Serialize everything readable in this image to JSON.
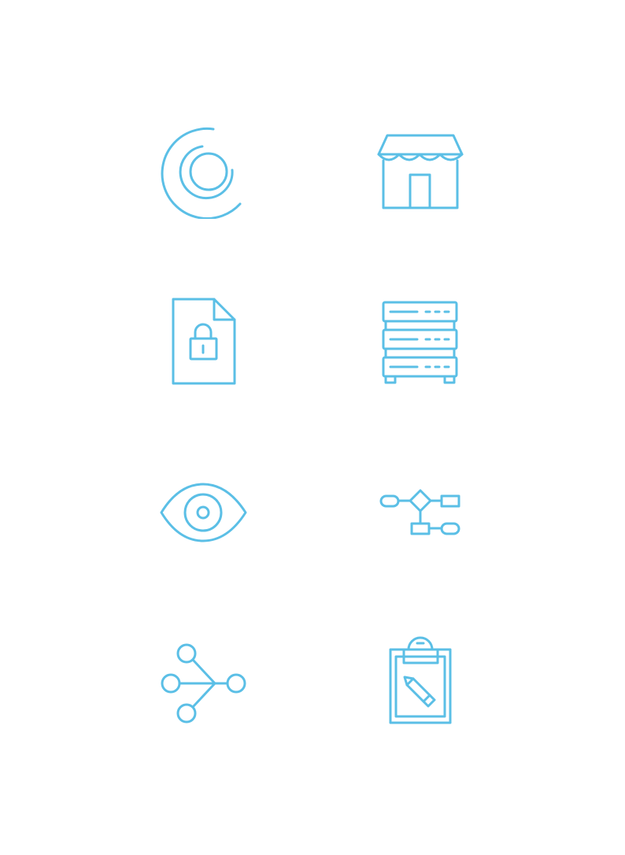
{
  "theme": {
    "icon_color": "#5bbfe6",
    "background": "#ffffff"
  },
  "icons": [
    {
      "name": "concentric-arcs-icon"
    },
    {
      "name": "storefront-icon"
    },
    {
      "name": "locked-document-icon"
    },
    {
      "name": "server-rack-icon"
    },
    {
      "name": "eye-icon"
    },
    {
      "name": "flowchart-icon"
    },
    {
      "name": "branching-nodes-icon"
    },
    {
      "name": "clipboard-pencil-icon"
    }
  ]
}
